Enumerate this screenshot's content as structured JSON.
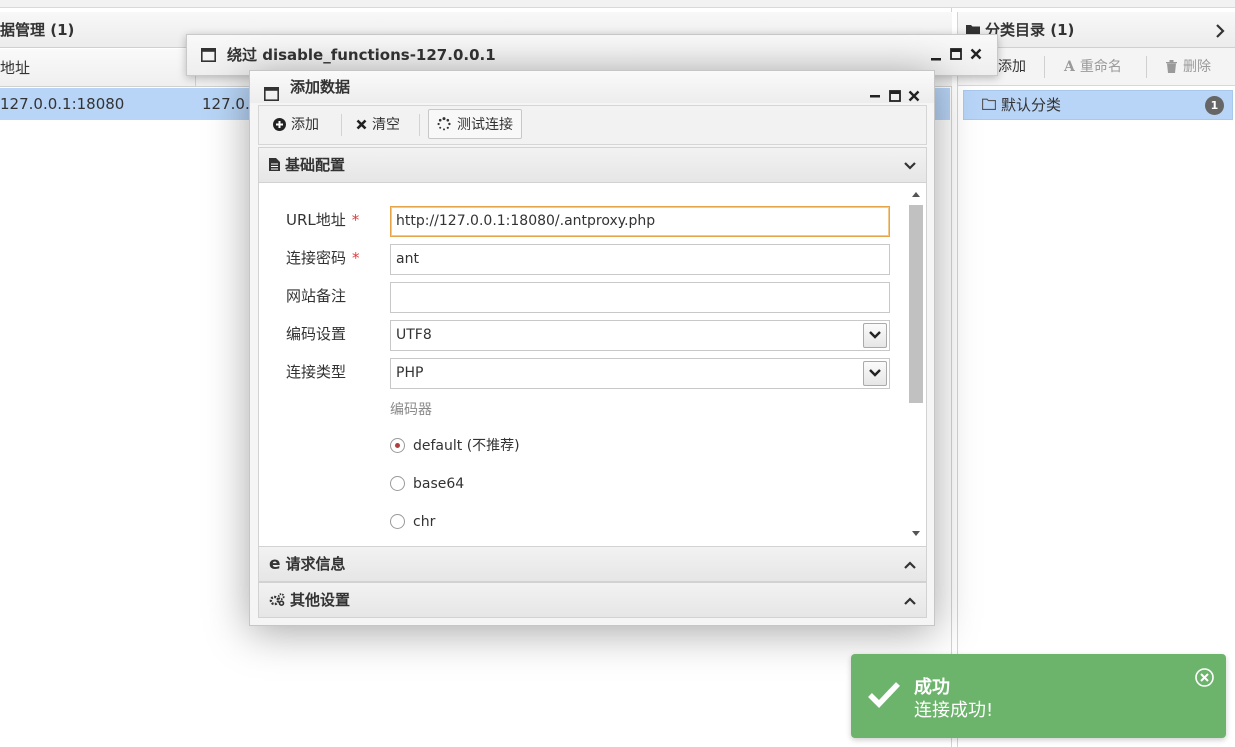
{
  "left": {
    "header": "据管理 (1)",
    "column_address": "地址",
    "row": {
      "url": "127.0.0.1:18080",
      "ip": "127.0."
    }
  },
  "right": {
    "header": "分类目录 (1)",
    "toolbar": {
      "add": "添加",
      "rename": "重命名",
      "delete": "删除"
    },
    "category": {
      "name": "默认分类",
      "count": "1"
    }
  },
  "outer_window": {
    "title": "绕过 disable_functions-127.0.0.1"
  },
  "dialog": {
    "title": "添加数据",
    "toolbar": {
      "add": "添加",
      "clear": "清空",
      "test": "测试连接"
    },
    "sections": {
      "basic": "基础配置",
      "request": "请求信息",
      "other": "其他设置"
    },
    "form": {
      "url_label": "URL地址",
      "url_value": "http://127.0.0.1:18080/.antproxy.php",
      "password_label": "连接密码",
      "password_value": "ant",
      "note_label": "网站备注",
      "note_value": "",
      "encoding_label": "编码设置",
      "encoding_value": "UTF8",
      "type_label": "连接类型",
      "type_value": "PHP",
      "encoder_label": "编码器",
      "encoders": [
        "default (不推荐)",
        "base64",
        "chr"
      ],
      "selected_encoder": "default (不推荐)",
      "required_mark": "*"
    }
  },
  "toast": {
    "title": "成功",
    "message": "连接成功!",
    "color": "#6cb36c"
  }
}
